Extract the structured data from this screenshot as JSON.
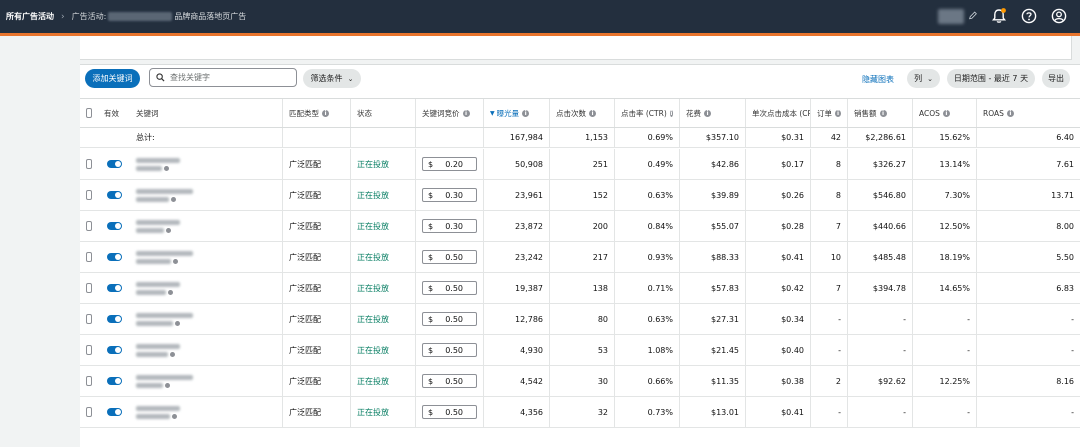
{
  "nav": {
    "breadcrumb_root": "所有广告活动",
    "breadcrumb_prefix": "广告活动:",
    "breadcrumb_suffix": "品牌商品落地页广告"
  },
  "toolbar": {
    "add_keyword_label": "添加关键词",
    "search_placeholder": "查找关键字",
    "filter_label": "筛选条件",
    "hide_chart_label": "隐藏图表",
    "columns_label": "列",
    "date_range_label": "日期范围 - 最近 7 天",
    "export_label": "导出"
  },
  "table": {
    "headers": {
      "enabled": "有效",
      "keyword": "关键词",
      "match_type": "匹配类型",
      "status": "状态",
      "bid": "关键词竞价",
      "impressions": "曝光量",
      "clicks": "点击次数",
      "ctr": "点击率 (CTR)",
      "spend": "花费",
      "cpc": "单次点击成本 (CPC)",
      "orders": "订单",
      "sales": "销售额",
      "acos": "ACOS",
      "roas": "ROAS"
    },
    "totals": {
      "label": "总计:",
      "impressions": "167,984",
      "clicks": "1,153",
      "ctr": "0.69%",
      "spend": "$357.10",
      "cpc": "$0.31",
      "orders": "42",
      "sales": "$2,286.61",
      "acos": "15.62%",
      "roas": "6.40"
    },
    "rows": [
      {
        "match": "广泛匹配",
        "status": "正在投放",
        "currency": "$",
        "bid": "0.20",
        "impressions": "50,908",
        "clicks": "251",
        "ctr": "0.49%",
        "spend": "$42.86",
        "cpc": "$0.17",
        "orders": "8",
        "sales": "$326.27",
        "acos": "13.14%",
        "roas": "7.61"
      },
      {
        "match": "广泛匹配",
        "status": "正在投放",
        "currency": "$",
        "bid": "0.30",
        "impressions": "23,961",
        "clicks": "152",
        "ctr": "0.63%",
        "spend": "$39.89",
        "cpc": "$0.26",
        "orders": "8",
        "sales": "$546.80",
        "acos": "7.30%",
        "roas": "13.71"
      },
      {
        "match": "广泛匹配",
        "status": "正在投放",
        "currency": "$",
        "bid": "0.30",
        "impressions": "23,872",
        "clicks": "200",
        "ctr": "0.84%",
        "spend": "$55.07",
        "cpc": "$0.28",
        "orders": "7",
        "sales": "$440.66",
        "acos": "12.50%",
        "roas": "8.00"
      },
      {
        "match": "广泛匹配",
        "status": "正在投放",
        "currency": "$",
        "bid": "0.50",
        "impressions": "23,242",
        "clicks": "217",
        "ctr": "0.93%",
        "spend": "$88.33",
        "cpc": "$0.41",
        "orders": "10",
        "sales": "$485.48",
        "acos": "18.19%",
        "roas": "5.50"
      },
      {
        "match": "广泛匹配",
        "status": "正在投放",
        "currency": "$",
        "bid": "0.50",
        "impressions": "19,387",
        "clicks": "138",
        "ctr": "0.71%",
        "spend": "$57.83",
        "cpc": "$0.42",
        "orders": "7",
        "sales": "$394.78",
        "acos": "14.65%",
        "roas": "6.83"
      },
      {
        "match": "广泛匹配",
        "status": "正在投放",
        "currency": "$",
        "bid": "0.50",
        "impressions": "12,786",
        "clicks": "80",
        "ctr": "0.63%",
        "spend": "$27.31",
        "cpc": "$0.34",
        "orders": "-",
        "sales": "-",
        "acos": "-",
        "roas": "-"
      },
      {
        "match": "广泛匹配",
        "status": "正在投放",
        "currency": "$",
        "bid": "0.50",
        "impressions": "4,930",
        "clicks": "53",
        "ctr": "1.08%",
        "spend": "$21.45",
        "cpc": "$0.40",
        "orders": "-",
        "sales": "-",
        "acos": "-",
        "roas": "-"
      },
      {
        "match": "广泛匹配",
        "status": "正在投放",
        "currency": "$",
        "bid": "0.50",
        "impressions": "4,542",
        "clicks": "30",
        "ctr": "0.66%",
        "spend": "$11.35",
        "cpc": "$0.38",
        "orders": "2",
        "sales": "$92.62",
        "acos": "12.25%",
        "roas": "8.16"
      },
      {
        "match": "广泛匹配",
        "status": "正在投放",
        "currency": "$",
        "bid": "0.50",
        "impressions": "4,356",
        "clicks": "32",
        "ctr": "0.73%",
        "spend": "$13.01",
        "cpc": "$0.41",
        "orders": "-",
        "sales": "-",
        "acos": "-",
        "roas": "-"
      }
    ]
  },
  "colors": {
    "nav_bg": "#232f3e",
    "nav_accent": "#e8742c",
    "primary": "#0a6fba",
    "status_green": "#067d62",
    "notification_dot": "#ff9900"
  },
  "icons": [
    "chevron-right-icon",
    "search-icon",
    "chevron-down-icon",
    "info-icon",
    "bell-icon",
    "help-icon",
    "user-icon",
    "pencil-icon",
    "sort-desc-icon"
  ]
}
